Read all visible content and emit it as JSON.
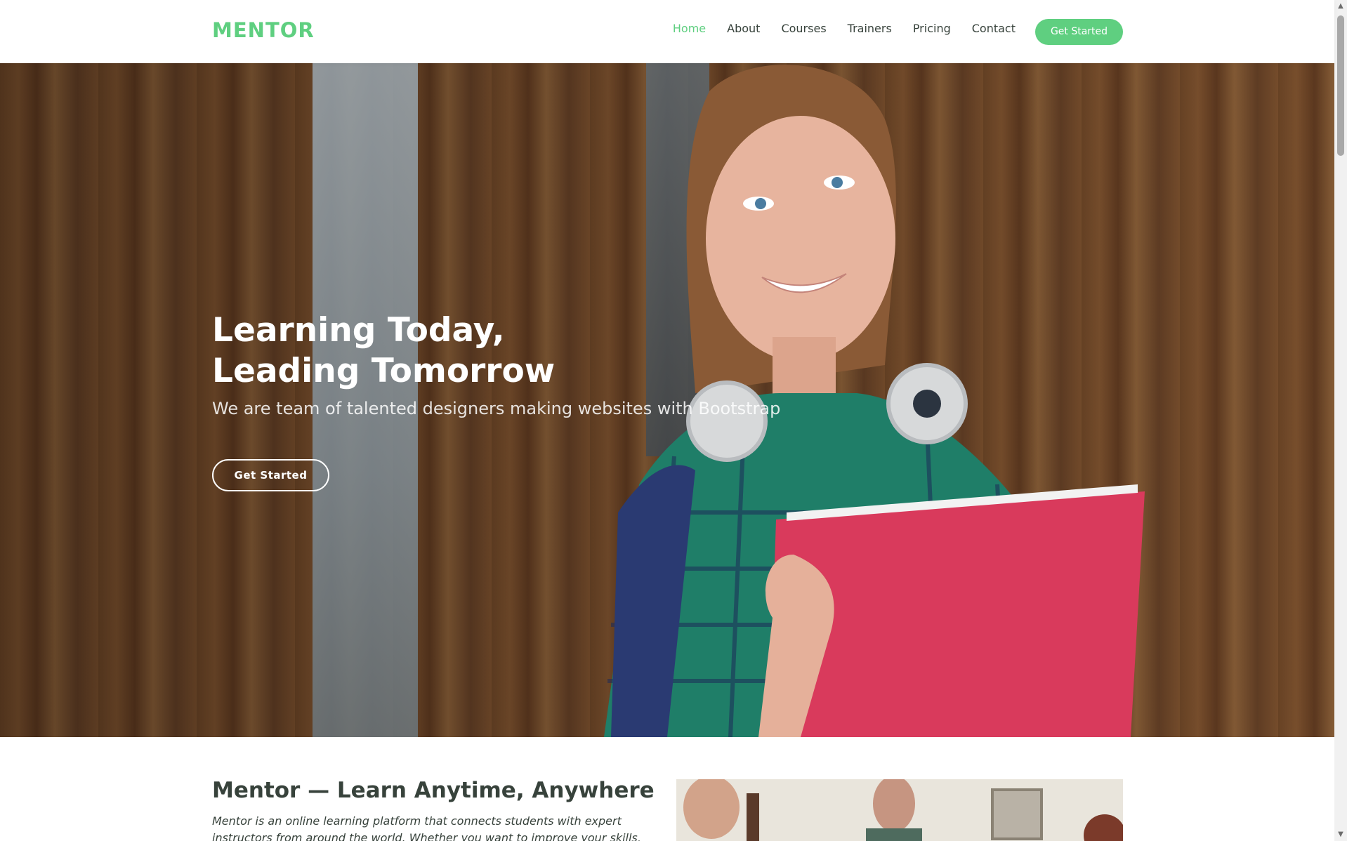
{
  "header": {
    "logo": "MENTOR",
    "nav": [
      {
        "label": "Home",
        "active": true
      },
      {
        "label": "About",
        "active": false
      },
      {
        "label": "Courses",
        "active": false
      },
      {
        "label": "Trainers",
        "active": false
      },
      {
        "label": "Pricing",
        "active": false
      },
      {
        "label": "Contact",
        "active": false
      }
    ],
    "cta_label": "Get Started"
  },
  "hero": {
    "title_line1": "Learning Today,",
    "title_line2": "Leading Tomorrow",
    "subtitle": "We are team of talented designers making websites with Bootstrap",
    "cta_label": "Get Started"
  },
  "about": {
    "title": "Mentor — Learn Anytime, Anywhere",
    "text": "Mentor is an online learning platform that connects students with expert instructors from around the world. Whether you want to improve your skills, explore new topics, or"
  },
  "colors": {
    "accent": "#5fcf80",
    "text": "#37423b"
  }
}
